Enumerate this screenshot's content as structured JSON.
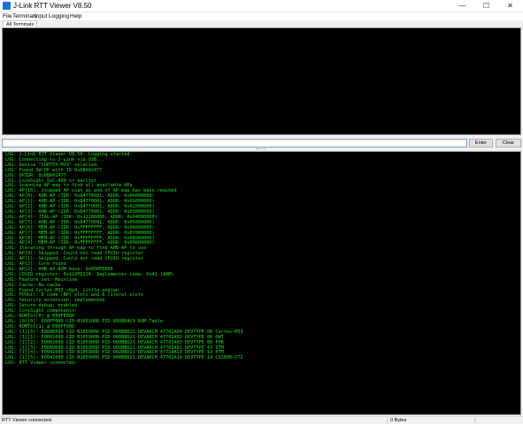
{
  "window": {
    "title": "J-Link RTT Viewer V8.50",
    "minimize_glyph": "—",
    "maximize_glyph": "☐",
    "close_glyph": "✕"
  },
  "menu": [
    "File",
    "Terminals",
    "Input",
    "Logging",
    "Help"
  ],
  "tabs": [
    "All Terminals"
  ],
  "input": {
    "value": "",
    "placeholder": ""
  },
  "buttons": {
    "enter": "Enter",
    "clear": "Clear"
  },
  "log_lines": [
    "LOG: J-Link RTT Viewer V8.50: Logging started.",
    "LOG: Connecting to J-Link via USB...",
    "LOG: Device \"CORTEX-M33\" selected.",
    "LOG: Found SW-DP with ID 0x6BA02477",
    "LOG: DPIDR: 0x6BA02477",
    "LOG: CoreSight SoC-400 or earlier",
    "LOG: Scanning AP map to find all available APs",
    "LOG: AP[10]: Stopped AP scan as end of AP map has been reached",
    "LOG: AP[0]: AHB-AP (IDR: 0x84770001, ADDR: 0x00000000)",
    "LOG: AP[1]: AHB-AP (IDR: 0x84770001, ADDR: 0x01000000)",
    "LOG: AP[2]: AHB-AP (IDR: 0x84770001, ADDR: 0x02000000)",
    "LOG: AP[3]: AHB-AP (IDR: 0x84770001, ADDR: 0x03000000)",
    "LOG: AP[4]: JTAG-AP (IDR: 0x12280000, ADDR: 0x04000000)",
    "LOG: AP[5]: AHB-AP (IDR: 0x84770001, ADDR: 0x05000000)",
    "LOG: AP[6]: MEM-AP (IDR: 0xFFFFFFFF, ADDR: 0x06000000)",
    "LOG: AP[7]: MEM-AP (IDR: 0xFFFFFFFF, ADDR: 0x07000000)",
    "LOG: AP[8]: MEM-AP (IDR: 0xFFFFFFFF, ADDR: 0x08000000)",
    "LOG: AP[9]: MEM-AP (IDR: 0xFFFFFFFF, ADDR: 0x09000000)",
    "LOG: Iterating through AP map to find AHB-AP to use",
    "LOG: AP[0]: Skipped. Could not read CPUID register",
    "LOG: AP[1]: Skipped. Could not read CPUID register",
    "LOG: AP[2]: Core found",
    "LOG: AP[2]: AHB-AP ROM base: 0xE00FE000",
    "LOG: CPUID register: 0x410FD214. Implementer code: 0x41 (ARM)",
    "LOG: Feature set: Mainline",
    "LOG: Cache: No cache",
    "LOG: Found Cortex-M33 r0p4, Little endian.",
    "LOG: FPUnit: 8 code (BP) slots and 0 literal slots",
    "LOG: Security extension: implemented",
    "LOG: Secure debug: enabled",
    "LOG: CoreSight components:",
    "LOG: ROMTbl[0] @ E00FE000",
    "LOG: [0][0]: E00FF000 CID B105100D PID 000BB4C9 ROM Table",
    "LOG: ROMTbl[1] @ E00FF000",
    "LOG: [1][0]: E000E000 CID B105900D PID 000BBD21 DEVARCH 47702A04 DEVTYPE 00 Cortex-M33",
    "LOG: [1][1]: E0001000 CID B105900D PID 000BBD21 DEVARCH 47701A02 DEVTYPE 00 DWT",
    "LOG: [1][2]: E0002000 CID B105900D PID 000BBD21 DEVARCH 47701A03 DEVTYPE 00 FPB",
    "LOG: [1][3]: E0000000 CID B105900D PID 000BBD21 DEVARCH 47701A01 DEVTYPE 43 ITM",
    "LOG: [1][4]: E0041000 CID B105900D PID 002BBD21 DEVARCH 47724A13 DEVTYPE 13 ETM",
    "LOG: [1][5]: E0042000 CID B105900D PID 000BBD21 DEVARCH 47701A14 DEVTYPE 14 CSS600-CTI",
    "LOG: RTT Viewer connected."
  ],
  "status": {
    "left": "RTT Viewer connected.",
    "middle": "0 Bytes"
  },
  "colors": {
    "log_text": "#19e619",
    "terminal_bg": "#000000",
    "app_icon": "#1f6fd1"
  }
}
